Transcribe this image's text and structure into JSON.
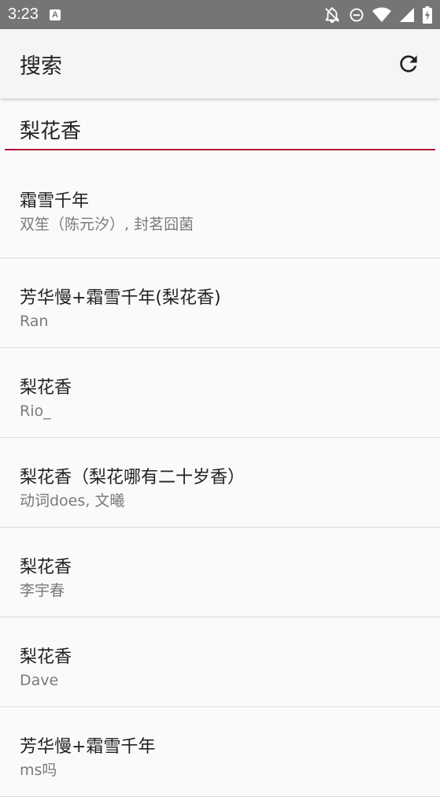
{
  "status_bar": {
    "time": "3:23",
    "app_badge": "A"
  },
  "app_bar": {
    "title": "搜索",
    "refresh_icon": "refresh-icon"
  },
  "search": {
    "value": "梨花香",
    "accent_color": "#b0143c"
  },
  "results": [
    {
      "title": "霜雪千年",
      "subtitle": "双笙（陈元汐）, 封茗囧菌"
    },
    {
      "title": "芳华慢+霜雪千年(梨花香)",
      "subtitle": "Ran"
    },
    {
      "title": "梨花香",
      "subtitle": "Rio_"
    },
    {
      "title": "梨花香（梨花哪有二十岁香）",
      "subtitle": "动词does, 文曦"
    },
    {
      "title": "梨花香",
      "subtitle": "李宇春"
    },
    {
      "title": "梨花香",
      "subtitle": "Dave"
    },
    {
      "title": "芳华慢+霜雪千年",
      "subtitle": "ms吗"
    }
  ]
}
